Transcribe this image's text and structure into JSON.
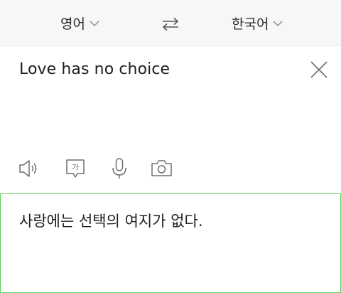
{
  "language_bar": {
    "source_language": "영어",
    "target_language": "한국어",
    "source_dropdown_icon": "chevron-down-icon",
    "target_dropdown_icon": "chevron-down-icon",
    "swap_icon": "swap-arrows-icon"
  },
  "input": {
    "text": "Love has no choice",
    "clear_icon": "close-icon"
  },
  "toolbar": {
    "tools": [
      {
        "name": "speaker",
        "icon": "speaker-icon"
      },
      {
        "name": "pronunciation",
        "icon": "chat-bubble-korean-icon",
        "glyph": "가"
      },
      {
        "name": "voice-input",
        "icon": "microphone-icon"
      },
      {
        "name": "camera",
        "icon": "camera-icon"
      }
    ]
  },
  "result": {
    "text": "사랑에는 선택의 여지가 없다."
  },
  "colors": {
    "result_border": "#5bd05b",
    "lang_bar_bg": "#f6f7f9",
    "icon_gray": "#7a7a7a"
  }
}
